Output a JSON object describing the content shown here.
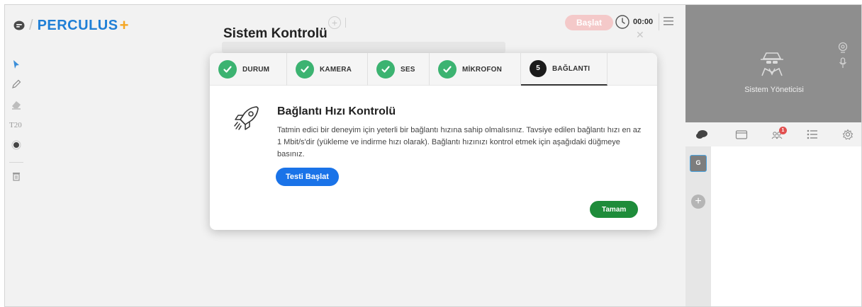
{
  "app": {
    "logo_text": "PERCULUS",
    "logo_plus": "+"
  },
  "toolbar": {
    "start_label": "Başlat",
    "timer": "00:00"
  },
  "dialog": {
    "title": "Sistem Kontrolü",
    "tabs": [
      {
        "label": "DURUM",
        "state": "done"
      },
      {
        "label": "KAMERA",
        "state": "done"
      },
      {
        "label": "SES",
        "state": "done"
      },
      {
        "label": "MİKROFON",
        "state": "done"
      },
      {
        "label": "BAĞLANTI",
        "state": "active",
        "step": "5"
      }
    ],
    "heading": "Bağlantı Hızı Kontrolü",
    "description": "Tatmin edici bir deneyim için yeterli bir bağlantı hızına sahip olmalısınız. Tavsiye edilen bağlantı hızı en az 1 Mbit/s'dir (yükleme ve indirme hızı olarak). Bağlantı hızınızı kontrol etmek için aşağıdaki düğmeye basınız.",
    "test_button": "Testi Başlat",
    "ok_button": "Tamam"
  },
  "left_tools": {
    "text_tool_label": "T20"
  },
  "video": {
    "user_name": "Sistem Yöneticisi"
  },
  "panel": {
    "participant_badge": "1",
    "group_tile": "G",
    "add_label": "+"
  },
  "colors": {
    "brand_blue": "#1f7fd6",
    "brand_plus": "#f5a623",
    "check_green": "#3cb371",
    "primary_blue": "#1a73e8",
    "ok_green": "#1e8c3a",
    "start_pink": "#f4c9c9",
    "video_gray": "#8e8e8e"
  }
}
